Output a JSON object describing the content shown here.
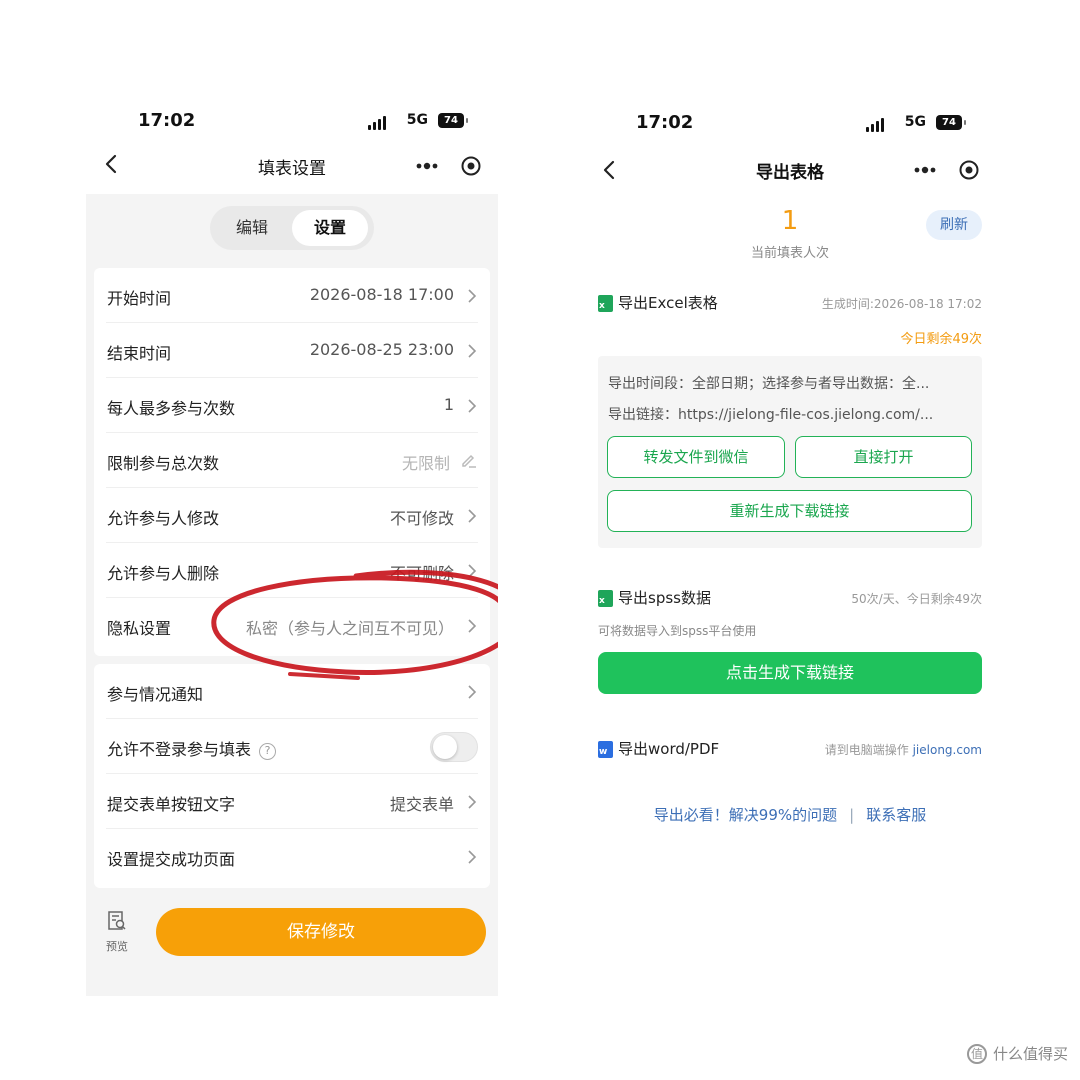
{
  "left": {
    "status": {
      "time": "17:02",
      "network": "5G",
      "battery": "74"
    },
    "nav": {
      "title": "填表设置"
    },
    "segment": {
      "edit": "编辑",
      "settings": "设置"
    },
    "rows1": [
      {
        "label": "开始时间",
        "value": "2026-08-18 17:00"
      },
      {
        "label": "结束时间",
        "value": "2026-08-25 23:00"
      },
      {
        "label": "每人最多参与次数",
        "value": "1"
      },
      {
        "label": "限制参与总次数",
        "value": "无限制"
      },
      {
        "label": "允许参与人修改",
        "value": "不可修改"
      },
      {
        "label": "允许参与人删除",
        "value": "不可删除"
      },
      {
        "label": "隐私设置",
        "value": "私密（参与人之间互不可见）"
      }
    ],
    "rows2": [
      {
        "label": "参与情况通知",
        "value": ""
      },
      {
        "label": "允许不登录参与填表",
        "help": "?"
      },
      {
        "label": "提交表单按钮文字",
        "value": "提交表单"
      },
      {
        "label": "设置提交成功页面",
        "value": ""
      }
    ],
    "bottom": {
      "preview": "预览",
      "save": "保存修改"
    }
  },
  "right": {
    "status": {
      "time": "17:02",
      "network": "5G",
      "battery": "74"
    },
    "nav": {
      "title": "导出表格"
    },
    "count": {
      "value": "1",
      "label": "当前填表人次",
      "refresh": "刷新"
    },
    "excel": {
      "title": "导出Excel表格",
      "generated": "生成时间:2026-08-18 17:02",
      "remaining": "今日剩余49次",
      "range": "导出时间段：全部日期；选择参与者导出数据：全...",
      "link": "导出链接：https://jielong-file-cos.jielong.com/...",
      "btn_forward": "转发文件到微信",
      "btn_open": "直接打开",
      "btn_regen": "重新生成下载链接"
    },
    "spss": {
      "title": "导出spss数据",
      "meta": "50次/天、今日剩余49次",
      "desc": "可将数据导入到spss平台使用",
      "btn": "点击生成下载链接"
    },
    "word": {
      "title": "导出word/PDF",
      "meta": "请到电脑端操作",
      "site": "jielong.com"
    },
    "footer": {
      "faq": "导出必看！解决99%的问题",
      "sep": "|",
      "service": "联系客服"
    }
  },
  "watermark": "什么值得买",
  "colors": {
    "orange": "#f7a008",
    "green": "#1fc25c",
    "link": "#3d6fb6",
    "red_annotation": "#c8161d"
  }
}
